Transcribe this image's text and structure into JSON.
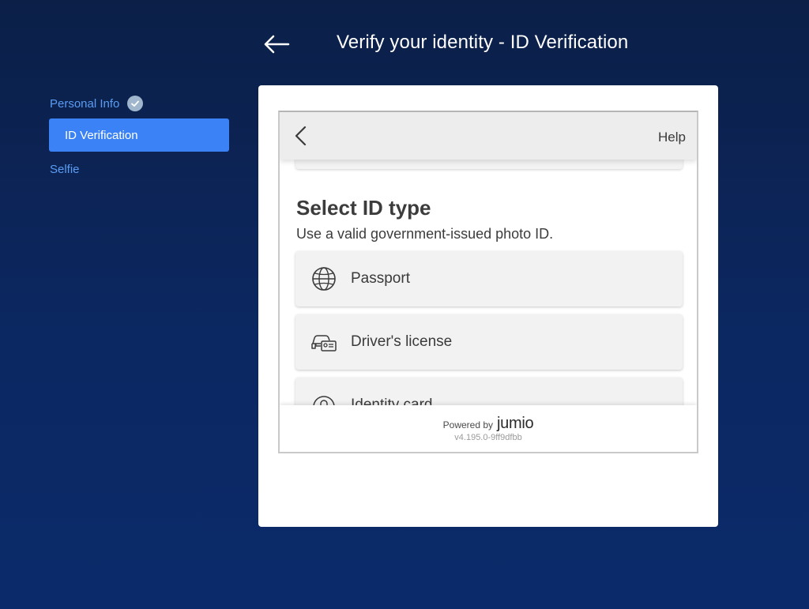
{
  "header": {
    "title": "Verify your identity - ID Verification",
    "back_icon": "arrow-left-icon"
  },
  "sidebar": {
    "steps": [
      {
        "label": "Personal Info",
        "status": "completed",
        "icon": "check-circle-icon"
      },
      {
        "label": "ID Verification",
        "status": "active"
      },
      {
        "label": "Selfie",
        "status": "pending"
      }
    ]
  },
  "widget": {
    "back_icon": "chevron-left-icon",
    "help_label": "Help",
    "title": "Select ID type",
    "subtitle": "Use a valid government-issued photo ID.",
    "options": [
      {
        "label": "Passport",
        "icon": "globe-icon"
      },
      {
        "label": "Driver's license",
        "icon": "car-license-icon"
      },
      {
        "label": "Identity card",
        "icon": "id-card-icon"
      }
    ],
    "footer": {
      "powered_by": "Powered by",
      "brand": "jumio",
      "version": "v4.195.0-9ff9dfbb"
    }
  },
  "colors": {
    "background_top": "#0b1f47",
    "background_bottom": "#0b2a6a",
    "accent": "#3b82f6",
    "step_link": "#5b9cf2"
  }
}
